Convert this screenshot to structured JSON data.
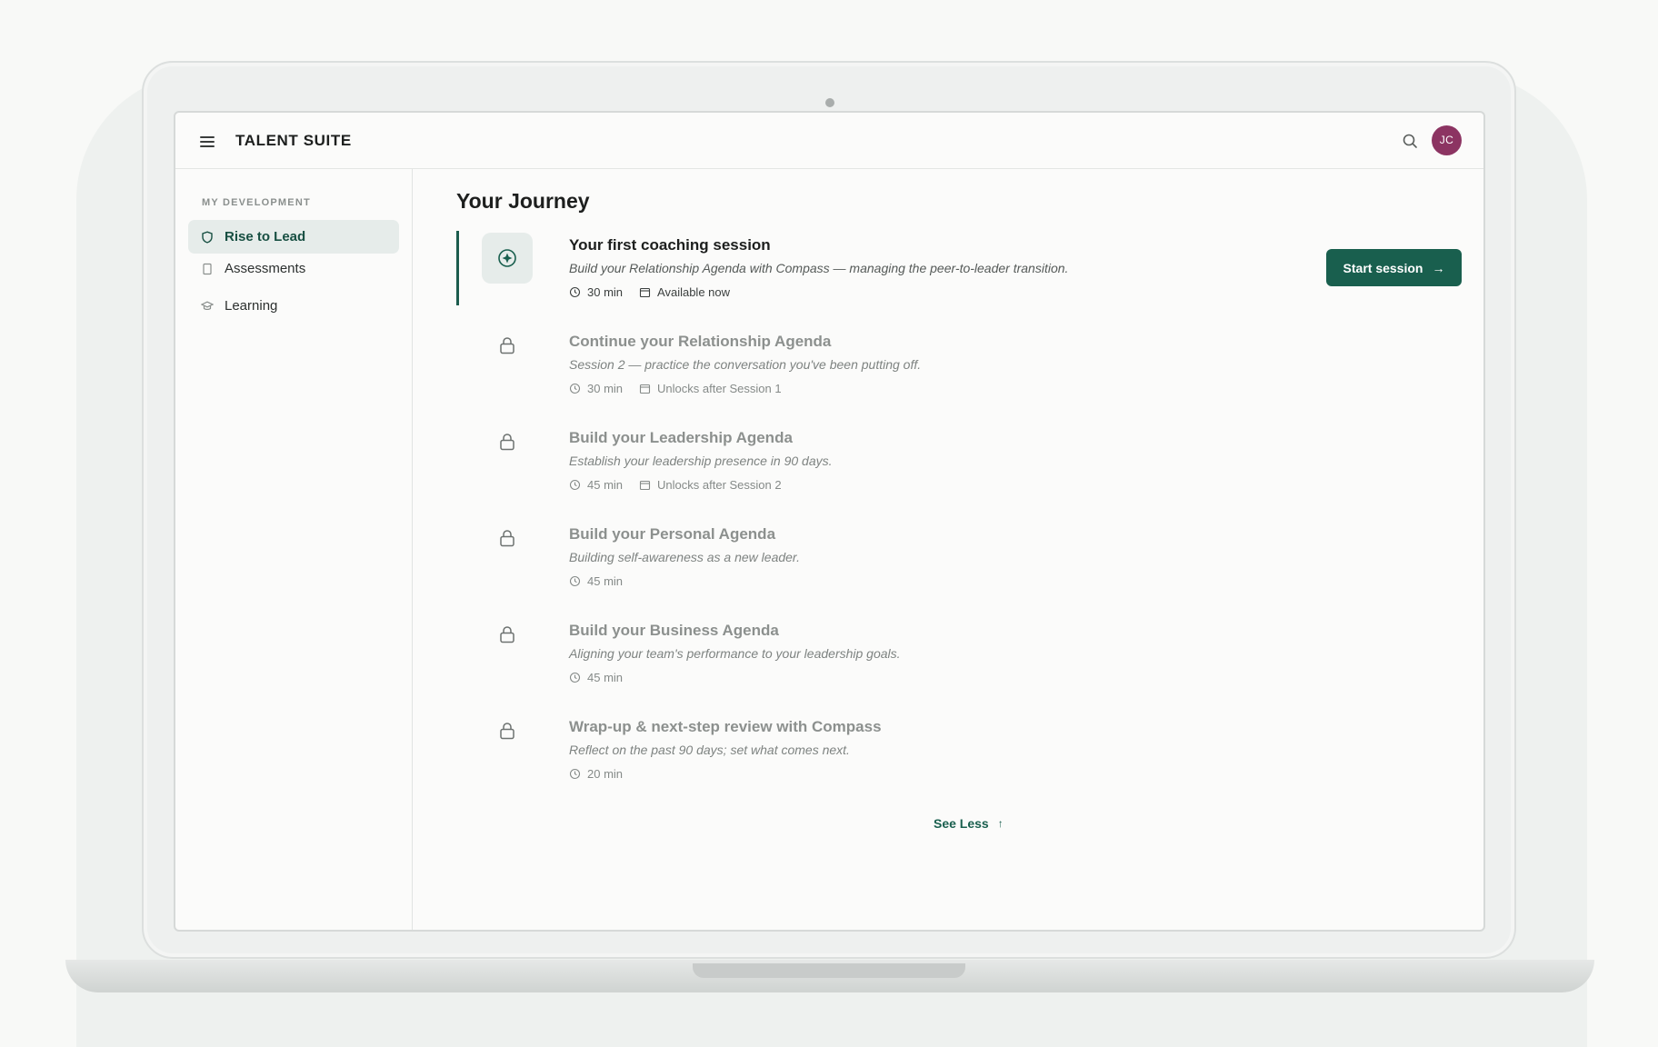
{
  "app": {
    "brand": "TALENT SUITE",
    "avatar_initials": "JC",
    "avatar_color": "#8c3462",
    "accent_color": "#195f4e"
  },
  "sidebar": {
    "heading": "MY DEVELOPMENT",
    "items": [
      {
        "label": "Rise to Lead",
        "icon": "shield-icon",
        "active": true
      },
      {
        "label": "Assessments",
        "icon": "document-icon",
        "active": false
      },
      {
        "label": "Learning",
        "icon": "graduation-cap-icon",
        "active": false
      }
    ]
  },
  "main": {
    "title": "Your Journey",
    "steps": [
      {
        "title": "Your first coaching session",
        "description": "Build your Relationship Agenda with Compass — managing the peer-to-leader transition.",
        "duration": "30 min",
        "availability": "Available now",
        "status": "active",
        "icon": "compass-icon"
      },
      {
        "title": "Continue your Relationship Agenda",
        "description": "Session 2 — practice the conversation you've been putting off.",
        "duration": "30 min",
        "availability": "Unlocks after Session 1",
        "status": "locked",
        "icon": "lock-icon"
      },
      {
        "title": "Build your Leadership Agenda",
        "description": "Establish your leadership presence in 90 days.",
        "duration": "45 min",
        "availability": "Unlocks after Session 2",
        "status": "locked",
        "icon": "lock-icon"
      },
      {
        "title": "Build your Personal Agenda",
        "description": "Building self-awareness as a new leader.",
        "duration": "45 min",
        "status": "locked",
        "icon": "lock-icon"
      },
      {
        "title": "Build your Business Agenda",
        "description": "Aligning your team's performance to your leadership goals.",
        "duration": "45 min",
        "status": "locked",
        "icon": "lock-icon"
      },
      {
        "title": "Wrap-up & next-step review with Compass",
        "description": "Reflect on the past 90 days; set what comes next.",
        "duration": "20 min",
        "status": "locked",
        "icon": "lock-icon"
      }
    ],
    "start_button": "Start session",
    "see_less": "See Less"
  }
}
